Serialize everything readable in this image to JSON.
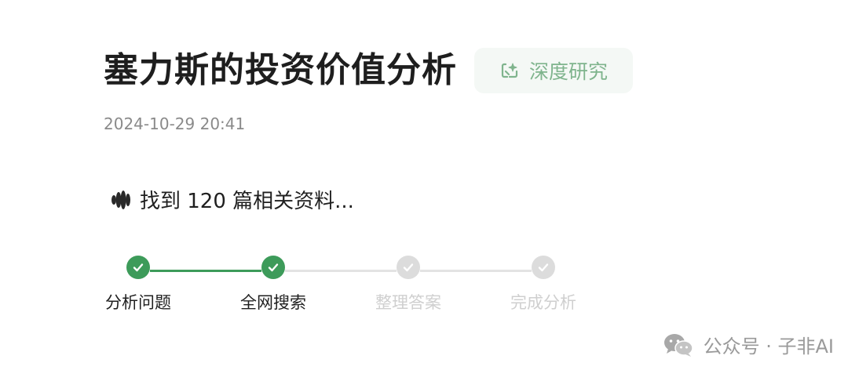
{
  "header": {
    "title": "塞力斯的投资价值分析",
    "badge_label": "深度研究",
    "badge_icon": "deep-research-icon"
  },
  "timestamp": "2024-10-29 20:41",
  "status": {
    "icon": "sound-wave-icon",
    "text": "找到 120 篇相关资料..."
  },
  "steps": [
    {
      "label": "分析问题",
      "state": "done"
    },
    {
      "label": "全网搜索",
      "state": "done"
    },
    {
      "label": "整理答案",
      "state": "pending"
    },
    {
      "label": "完成分析",
      "state": "pending"
    }
  ],
  "colors": {
    "accent": "#3d9b5a",
    "accent_soft": "#7fb48d",
    "pending_dot": "#dcdcdc",
    "pending_track": "#e3e3e3",
    "pending_label": "#cfcfcf",
    "done_label": "#1f1f1f"
  },
  "watermark": {
    "icon": "wechat-icon",
    "text": "公众号 · 子非AI"
  }
}
